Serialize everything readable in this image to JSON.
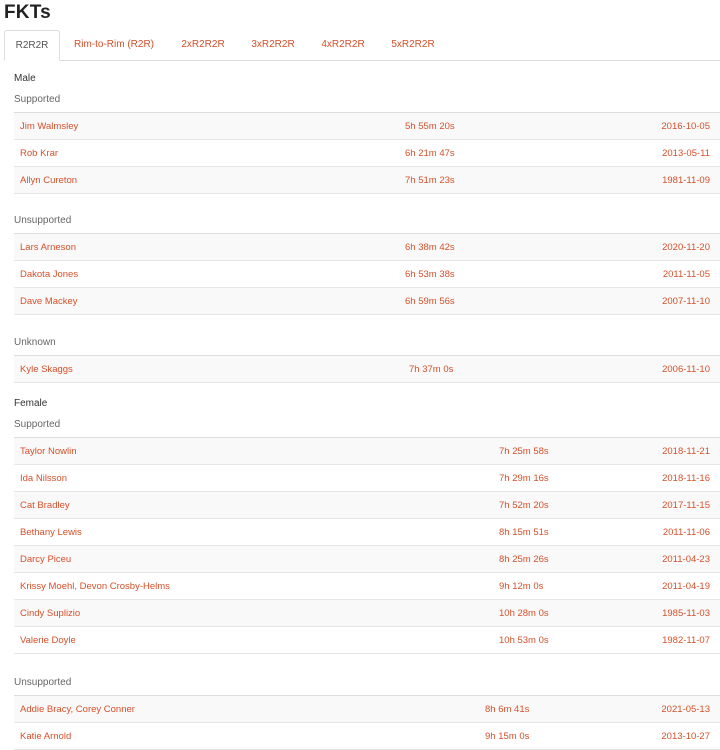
{
  "page": {
    "title": "FKTs"
  },
  "tabs": [
    {
      "label": "R2R2R",
      "active": true
    },
    {
      "label": "Rim-to-Rim (R2R)",
      "active": false
    },
    {
      "label": "2xR2R2R",
      "active": false
    },
    {
      "label": "3xR2R2R",
      "active": false
    },
    {
      "label": "4xR2R2R",
      "active": false
    },
    {
      "label": "5xR2R2R",
      "active": false
    }
  ],
  "male": {
    "label": "Male",
    "supported": {
      "label": "Supported",
      "rows": [
        {
          "name": "Jim Walmsley",
          "time": "5h 55m 20s",
          "date": "2016-10-05"
        },
        {
          "name": "Rob Krar",
          "time": "6h 21m 47s",
          "date": "2013-05-11"
        },
        {
          "name": "Allyn Cureton",
          "time": "7h 51m 23s",
          "date": "1981-11-09"
        }
      ]
    },
    "unsupported": {
      "label": "Unsupported",
      "rows": [
        {
          "name": "Lars Arneson",
          "time": "6h 38m 42s",
          "date": "2020-11-20"
        },
        {
          "name": "Dakota Jones",
          "time": "6h 53m 38s",
          "date": "2011-11-05"
        },
        {
          "name": "Dave Mackey",
          "time": "6h 59m 56s",
          "date": "2007-11-10"
        }
      ]
    },
    "unknown": {
      "label": "Unknown",
      "rows": [
        {
          "name": "Kyle Skaggs",
          "time": "7h 37m 0s",
          "date": "2006-11-10"
        }
      ]
    }
  },
  "female": {
    "label": "Female",
    "supported": {
      "label": "Supported",
      "rows": [
        {
          "name": "Taylor Nowlin",
          "time": "7h 25m 58s",
          "date": "2018-11-21"
        },
        {
          "name": "Ida Nilsson",
          "time": "7h 29m 16s",
          "date": "2018-11-16"
        },
        {
          "name": "Cat Bradley",
          "time": "7h 52m 20s",
          "date": "2017-11-15"
        },
        {
          "name": "Bethany Lewis",
          "time": "8h 15m 51s",
          "date": "2011-11-06"
        },
        {
          "name": "Darcy Piceu",
          "time": "8h 25m 26s",
          "date": "2011-04-23"
        },
        {
          "name": "Krissy Moehl, Devon Crosby-Helms",
          "time": "9h 12m 0s",
          "date": "2011-04-19"
        },
        {
          "name": "Cindy Suplizio",
          "time": "10h 28m 0s",
          "date": "1985-11-03"
        },
        {
          "name": "Valerie Doyle",
          "time": "10h 53m 0s",
          "date": "1982-11-07"
        }
      ]
    },
    "unsupported": {
      "label": "Unsupported",
      "rows": [
        {
          "name": "Addie Bracy, Corey Conner",
          "time": "8h 6m 41s",
          "date": "2021-05-13"
        },
        {
          "name": "Katie Arnold",
          "time": "9h 15m 0s",
          "date": "2013-10-27"
        }
      ]
    }
  }
}
